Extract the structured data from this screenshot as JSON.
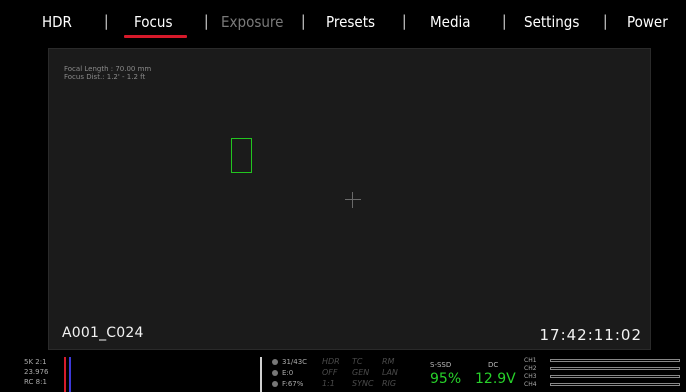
{
  "menu": {
    "items": [
      {
        "label": "HDR",
        "disabled": false
      },
      {
        "label": "Focus",
        "disabled": false,
        "active": true
      },
      {
        "label": "Exposure",
        "disabled": true
      },
      {
        "label": "Presets",
        "disabled": false
      },
      {
        "label": "Media",
        "disabled": false
      },
      {
        "label": "Settings",
        "disabled": false
      },
      {
        "label": "Power",
        "disabled": false
      }
    ],
    "separator": "|",
    "active_color": "#d6192a"
  },
  "viewport": {
    "lens_focal": "Focal Length : 70.00 mm",
    "lens_focus": "Focus Dist.: 1.2' - 1.2 ft",
    "clip_name": "A001_C024",
    "timecode": "17:42:11:02",
    "focus_box_color": "#22c51f"
  },
  "status": {
    "format_lines": [
      "5K 2:1",
      "23.976",
      "RC 8:1"
    ],
    "temps": [
      "31/43C",
      "E:0",
      "F:67%"
    ],
    "flags": [
      "HDR",
      "TC",
      "RM",
      "OFF",
      "GEN",
      "LAN",
      "1:1",
      "SYNC",
      "RIG"
    ],
    "media_label": "S-SSD",
    "media_value": "95%",
    "dc_label": "DC",
    "dc_value": "12.9V",
    "channels": [
      "CH1",
      "CH2",
      "CH3",
      "CH4"
    ],
    "ok_color": "#27d12a"
  }
}
